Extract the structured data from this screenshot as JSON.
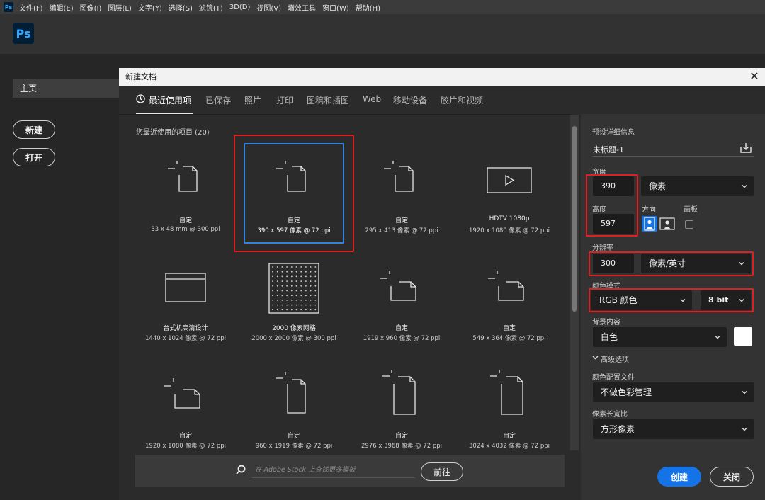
{
  "menubar": {
    "logo": "Ps",
    "items": [
      "文件(F)",
      "编辑(E)",
      "图像(I)",
      "图层(L)",
      "文字(Y)",
      "选择(S)",
      "滤镜(T)",
      "3D(D)",
      "视图(V)",
      "增效工具",
      "窗口(W)",
      "帮助(H)"
    ]
  },
  "app_logo": "Ps",
  "home": {
    "home_label": "主页",
    "new_label": "新建",
    "open_label": "打开"
  },
  "dialog": {
    "title": "新建文档",
    "close_glyph": "✕",
    "tabs": [
      "最近使用项",
      "已保存",
      "照片",
      "打印",
      "图稿和插图",
      "Web",
      "移动设备",
      "胶片和视频"
    ],
    "recent_label": "您最近使用的项目 (20)",
    "tiles": [
      {
        "name": "自定",
        "size": "33 x 48 mm @ 300 ppi",
        "icon": "portrait-doc-icon"
      },
      {
        "name": "自定",
        "size": "390 x 597 像素 @ 72 ppi",
        "icon": "portrait-doc-icon"
      },
      {
        "name": "自定",
        "size": "295 x 413 像素 @ 72 ppi",
        "icon": "portrait-doc-icon"
      },
      {
        "name": "HDTV 1080p",
        "size": "1920 x 1080 像素 @ 72 ppi",
        "icon": "video-icon"
      },
      {
        "name": "台式机高清设计",
        "size": "1440 x 1024 像素 @ 72 ppi",
        "icon": "browser-window-icon"
      },
      {
        "name": "2000 像素网格",
        "size": "2000 x 2000 像素 @ 300 ppi",
        "icon": "dot-grid-icon"
      },
      {
        "name": "自定",
        "size": "1919 x 960 像素 @ 72 ppi",
        "icon": "landscape-doc-icon"
      },
      {
        "name": "自定",
        "size": "549 x 364 像素 @ 72 ppi",
        "icon": "landscape-doc-icon"
      },
      {
        "name": "自定",
        "size": "1920 x 1080 像素 @ 72 ppi",
        "icon": "landscape-doc-icon"
      },
      {
        "name": "自定",
        "size": "960 x 1919 像素 @ 72 ppi",
        "icon": "portrait-doc-icon"
      },
      {
        "name": "自定",
        "size": "2976 x 3968 像素 @ 72 ppi",
        "icon": "portrait-doc-icon"
      },
      {
        "name": "自定",
        "size": "3024 x 4032 像素 @ 72 ppi",
        "icon": "portrait-doc-icon"
      }
    ],
    "stock": {
      "placeholder": "在 Adobe Stock 上查找更多模板",
      "go_label": "前往"
    },
    "details": {
      "heading": "预设详细信息",
      "doc_name": "未标题-1",
      "width_label": "宽度",
      "width_value": "390",
      "width_unit": "像素",
      "height_label": "高度",
      "height_value": "597",
      "orientation_label": "方向",
      "artboard_label": "画板",
      "resolution_label": "分辨率",
      "resolution_value": "300",
      "resolution_unit": "像素/英寸",
      "color_mode_label": "颜色模式",
      "color_mode_value": "RGB 颜色",
      "bit_depth_value": "8 bit",
      "bg_label": "背景内容",
      "bg_value": "白色",
      "advanced_label": "高级选项",
      "profile_label": "颜色配置文件",
      "profile_value": "不做色彩管理",
      "pixel_aspect_label": "像素长宽比",
      "pixel_aspect_value": "方形像素"
    },
    "create_label": "创建",
    "close_label": "关闭"
  },
  "colors": {
    "accent_blue": "#1473e6",
    "selection_blue": "#2f84e0",
    "highlight_red": "#e02020"
  }
}
